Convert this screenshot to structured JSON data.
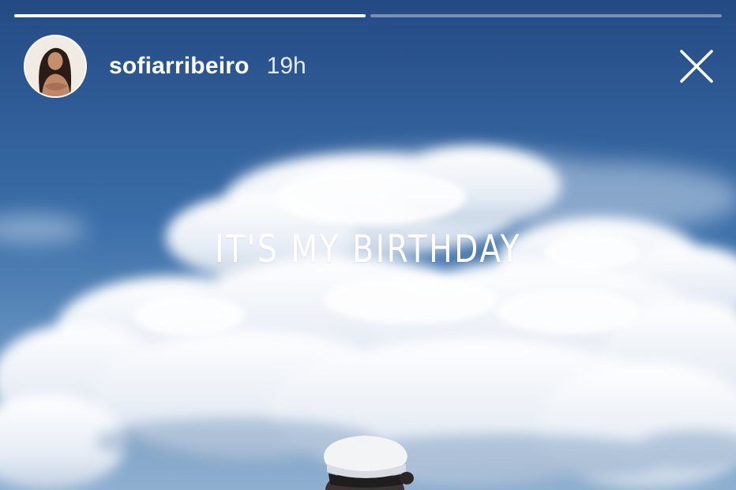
{
  "story": {
    "username": "sofiarribeiro",
    "timestamp": "19h",
    "caption": "IT'S MY BIRTHDAY",
    "segment_count": 2,
    "active_segment_index": 0,
    "active_segment_progress": 1.0
  },
  "icons": {
    "close": "close-icon",
    "avatar": "profile-photo"
  },
  "colors": {
    "sky_top": "#244a83",
    "sky_mid": "#3b6ea8",
    "cloud": "#ffffff",
    "text": "#ffffff"
  }
}
